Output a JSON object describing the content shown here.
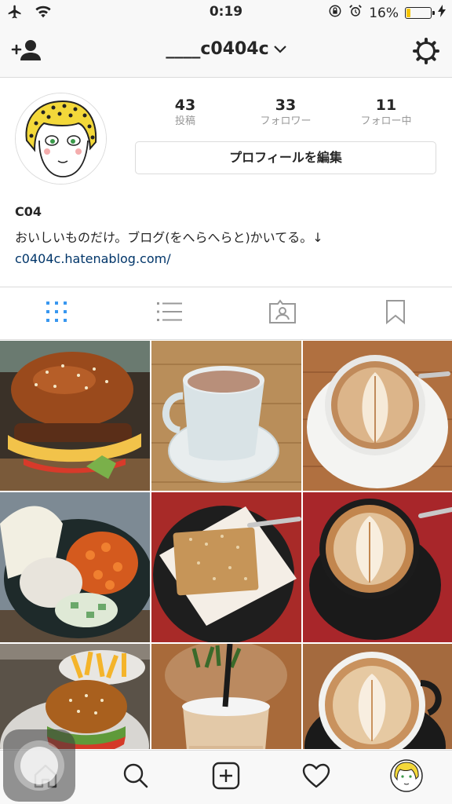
{
  "status_bar": {
    "time": "0:19",
    "battery_percent": "16%",
    "battery_level": 0.16,
    "icons": [
      "airplane-icon",
      "wifi-icon",
      "orientation-lock-icon",
      "alarm-icon",
      "battery-icon",
      "charging-icon"
    ]
  },
  "nav": {
    "username": "____c0404c",
    "left_icon": "add-user-icon",
    "right_icon": "settings-gear-icon"
  },
  "profile": {
    "stats": [
      {
        "value": "43",
        "label": "投稿"
      },
      {
        "value": "33",
        "label": "フォロワー"
      },
      {
        "value": "11",
        "label": "フォロー中"
      }
    ],
    "edit_button": "プロフィールを編集",
    "display_name": "C04",
    "bio": "おいしいものだけ。ブログ(をへらへらと)かいてる。↓",
    "link": "c0404c.hatenablog.com/"
  },
  "tabs": [
    "grid-view-icon",
    "list-view-icon",
    "tagged-photos-icon",
    "saved-bookmark-icon"
  ],
  "grid": {
    "posts": [
      {
        "subject": "hamburger"
      },
      {
        "subject": "hot chocolate"
      },
      {
        "subject": "latte art"
      },
      {
        "subject": "curry plate"
      },
      {
        "subject": "coconut cake"
      },
      {
        "subject": "latte art"
      },
      {
        "subject": "burger and fries"
      },
      {
        "subject": "iced latte"
      },
      {
        "subject": "latte art"
      }
    ]
  },
  "bottom_nav": [
    "home-icon",
    "search-icon",
    "add-post-icon",
    "activity-heart-icon",
    "profile-avatar-icon"
  ],
  "colors": {
    "accent_blue": "#3897f0",
    "link_blue": "#003569",
    "battery_yellow": "#f5c400"
  }
}
